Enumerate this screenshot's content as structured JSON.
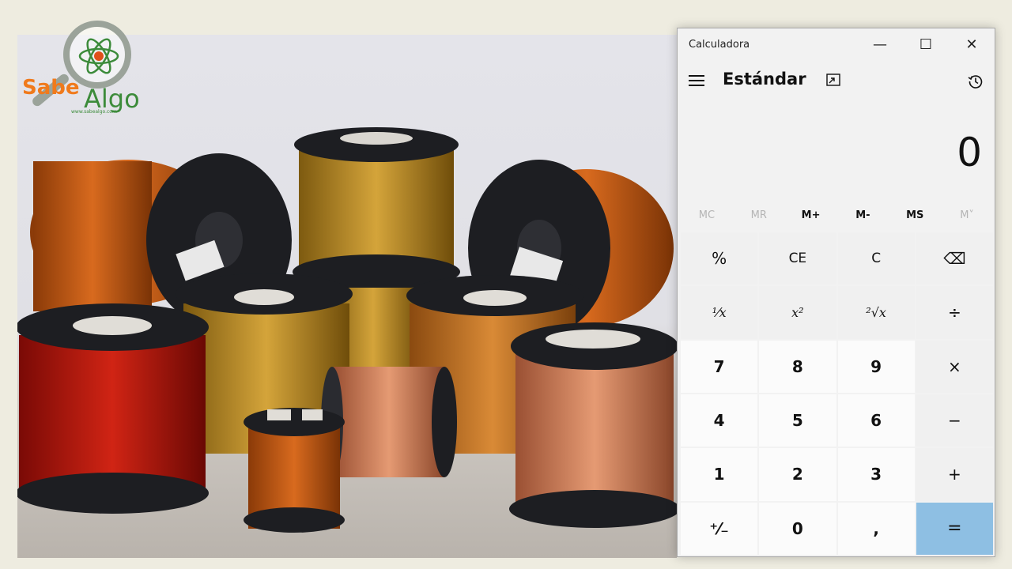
{
  "logo": {
    "brand_left": "Sabe",
    "brand_right": "Algo",
    "url": "www.sabealgo.com"
  },
  "calculator": {
    "window_title": "Calculadora",
    "window_controls": {
      "minimize": "—",
      "maximize": "☐",
      "close": "✕"
    },
    "mode": "Estándar",
    "display_value": "0",
    "memory_buttons": [
      {
        "label": "MC",
        "enabled": false
      },
      {
        "label": "MR",
        "enabled": false
      },
      {
        "label": "M+",
        "enabled": true
      },
      {
        "label": "M-",
        "enabled": true
      },
      {
        "label": "MS",
        "enabled": true
      },
      {
        "label": "M˅",
        "enabled": false
      }
    ],
    "keys": [
      [
        "%",
        "CE",
        "C",
        "⌫"
      ],
      [
        "¹⁄x",
        "x²",
        "²√x",
        "÷"
      ],
      [
        "7",
        "8",
        "9",
        "×"
      ],
      [
        "4",
        "5",
        "6",
        "−"
      ],
      [
        "1",
        "2",
        "3",
        "+"
      ],
      [
        "⁺⁄₋",
        "0",
        ",",
        "="
      ]
    ],
    "accent_color": "#8ebfe3"
  }
}
